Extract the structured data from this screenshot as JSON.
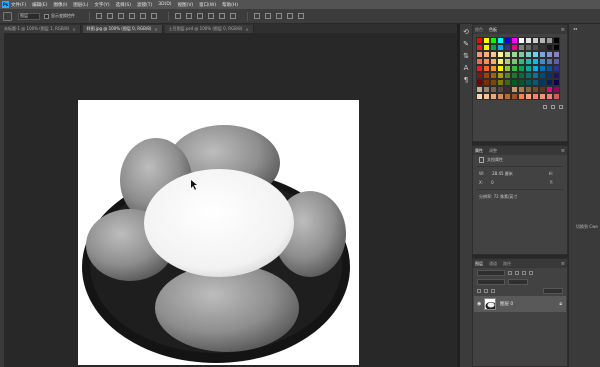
{
  "menubar": {
    "items": [
      "文件(F)",
      "编辑(E)",
      "图像(I)",
      "图层(L)",
      "文字(Y)",
      "选择(S)",
      "滤镜(T)",
      "3D(D)",
      "视图(V)",
      "窗口(W)",
      "帮助(H)"
    ]
  },
  "options": {
    "sample_select": "图层",
    "auto_select_label": "显示变换控件"
  },
  "tabs": [
    {
      "label": "未标题-1 @ 100% (图层 1, RGB/8)",
      "active": false
    },
    {
      "label": "样图.jpg @ 100% (图层 0, RGB/8)",
      "active": true
    },
    {
      "label": "土豆图层.psd @ 100% (图层 0, RGB/8)",
      "active": false
    }
  ],
  "panels": {
    "swatches": {
      "tabs": [
        "颜色",
        "色板"
      ],
      "active": "色板",
      "menu_icon": "panel-menu-icon"
    },
    "properties": {
      "tabs": [
        "属性",
        "调整"
      ],
      "doc_label": "文档属性",
      "width_label": "W:",
      "width_value": "28.45 厘米",
      "height_label": "H:",
      "height_value": "0",
      "x_label": "X:",
      "y_label": "Y:",
      "resolution_label": "分辨率: 72 像素/英寸"
    },
    "layers": {
      "tabs": [
        "图层",
        "通道",
        "路径"
      ],
      "active": "图层",
      "layer_name": "图层 0",
      "visibility_icon": "eye-icon",
      "lock_icon": "lock-icon"
    }
  },
  "dock": {
    "label": "切换到 Cwe"
  },
  "colors": {
    "ui_dark": "#282828",
    "panel": "#424242",
    "accent": "#31a8ff"
  }
}
